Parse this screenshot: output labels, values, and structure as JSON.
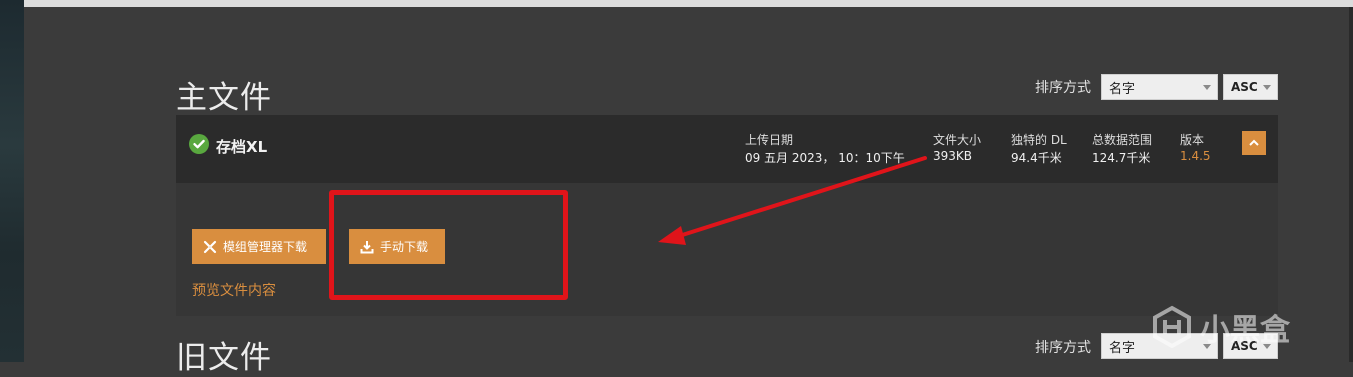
{
  "main_section": {
    "title": "主文件",
    "sort_label": "排序方式",
    "sort_select": "名字",
    "order_select": "ASC"
  },
  "file": {
    "name": "存档XL",
    "upload_label": "上传日期",
    "upload_value": "09 五月 2023， 10：10下午",
    "size_label": "文件大小",
    "size_value": "393KB",
    "unique_dl_label": "独特的 DL",
    "unique_dl_value": "94.4千米",
    "total_dl_label": "总数据范围",
    "total_dl_value": "124.7千米",
    "version_label": "版本",
    "version_value": "1.4.5",
    "mod_manager_button": "模组管理器下载",
    "manual_download_button": "手动下载",
    "preview_link": "预览文件内容"
  },
  "old_section": {
    "title": "旧文件",
    "sort_label": "排序方式",
    "sort_select": "名字",
    "order_select": "ASC"
  },
  "watermark": "小黑盒",
  "colors": {
    "accent": "#d98e3f",
    "annotation_red": "#e0141a",
    "check_green": "#59a83f"
  }
}
